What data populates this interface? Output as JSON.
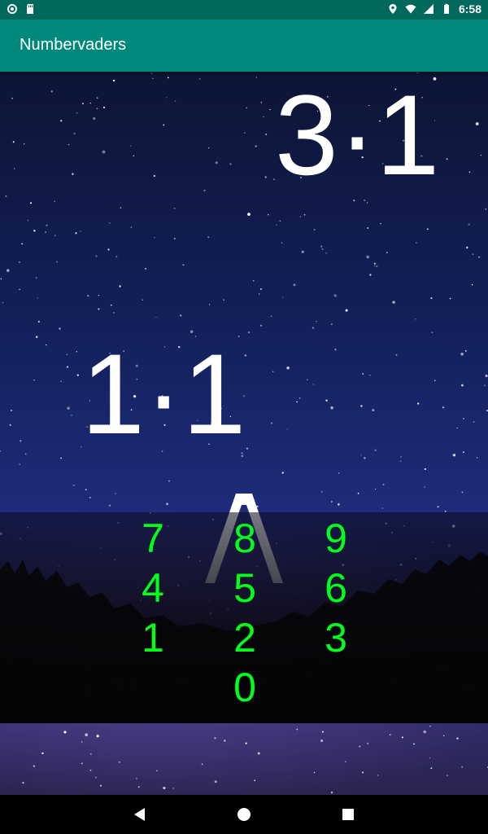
{
  "status_bar": {
    "time": "6:58",
    "left_icons": [
      "circle-notification-icon",
      "sd-card-icon"
    ],
    "right_icons": [
      "location-pin-icon",
      "wifi-icon",
      "signal-icon",
      "battery-icon"
    ]
  },
  "app_bar": {
    "title": "Numbervaders"
  },
  "game": {
    "enemies": [
      {
        "text": "3·1"
      },
      {
        "text": "1·1"
      }
    ],
    "shooter_symbol": "/\\"
  },
  "keypad": {
    "keys": [
      "7",
      "8",
      "9",
      "4",
      "5",
      "6",
      "1",
      "2",
      "3",
      "0"
    ],
    "color": "#00ff1a"
  },
  "nav_bar": {
    "buttons": [
      "back-icon",
      "home-icon",
      "recents-icon"
    ]
  },
  "colors": {
    "status_bar": "#00695c",
    "app_bar": "#00897b"
  }
}
